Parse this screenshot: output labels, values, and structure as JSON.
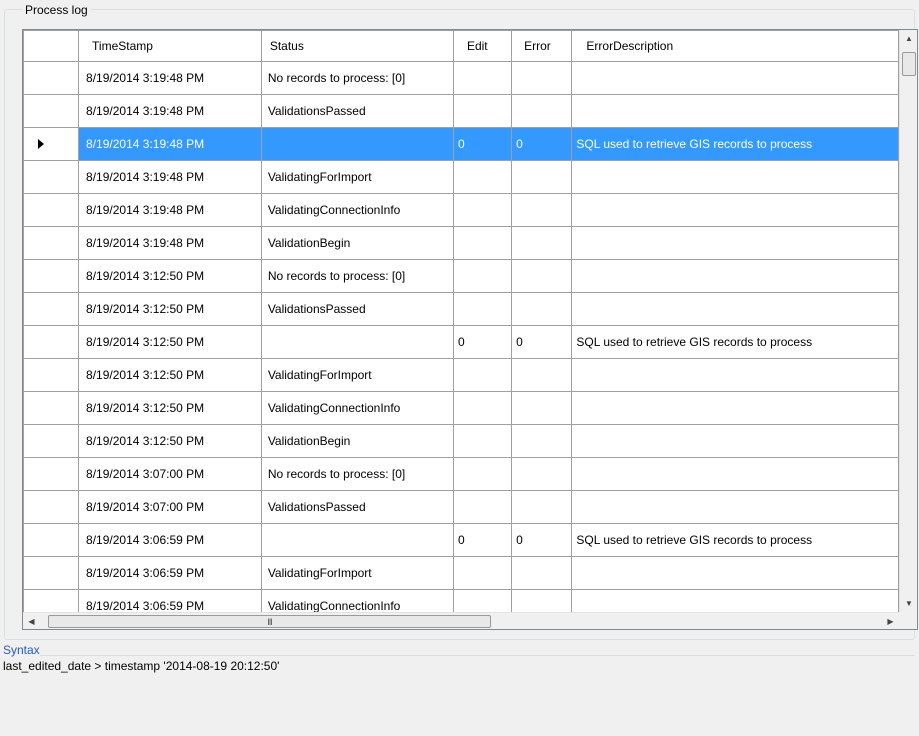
{
  "process_log": {
    "title": "Process log",
    "columns": [
      "TimeStamp",
      "Status",
      "Edit",
      "Error",
      "ErrorDescription"
    ],
    "selected_row": 2,
    "rows": [
      {
        "timestamp": "8/19/2014 3:19:48 PM",
        "status": "No records to process: [0]",
        "edit": "",
        "error": "",
        "description": ""
      },
      {
        "timestamp": "8/19/2014 3:19:48 PM",
        "status": "ValidationsPassed",
        "edit": "",
        "error": "",
        "description": ""
      },
      {
        "timestamp": "8/19/2014 3:19:48 PM",
        "status": "",
        "edit": "0",
        "error": "0",
        "description": "SQL used to retrieve GIS records to process"
      },
      {
        "timestamp": "8/19/2014 3:19:48 PM",
        "status": "ValidatingForImport",
        "edit": "",
        "error": "",
        "description": ""
      },
      {
        "timestamp": "8/19/2014 3:19:48 PM",
        "status": "ValidatingConnectionInfo",
        "edit": "",
        "error": "",
        "description": ""
      },
      {
        "timestamp": "8/19/2014 3:19:48 PM",
        "status": "ValidationBegin",
        "edit": "",
        "error": "",
        "description": ""
      },
      {
        "timestamp": "8/19/2014 3:12:50 PM",
        "status": "No records to process: [0]",
        "edit": "",
        "error": "",
        "description": ""
      },
      {
        "timestamp": "8/19/2014 3:12:50 PM",
        "status": "ValidationsPassed",
        "edit": "",
        "error": "",
        "description": ""
      },
      {
        "timestamp": "8/19/2014 3:12:50 PM",
        "status": "",
        "edit": "0",
        "error": "0",
        "description": "SQL used to retrieve GIS records to process"
      },
      {
        "timestamp": "8/19/2014 3:12:50 PM",
        "status": "ValidatingForImport",
        "edit": "",
        "error": "",
        "description": ""
      },
      {
        "timestamp": "8/19/2014 3:12:50 PM",
        "status": "ValidatingConnectionInfo",
        "edit": "",
        "error": "",
        "description": ""
      },
      {
        "timestamp": "8/19/2014 3:12:50 PM",
        "status": "ValidationBegin",
        "edit": "",
        "error": "",
        "description": ""
      },
      {
        "timestamp": "8/19/2014 3:07:00 PM",
        "status": "No records to process: [0]",
        "edit": "",
        "error": "",
        "description": ""
      },
      {
        "timestamp": "8/19/2014 3:07:00 PM",
        "status": "ValidationsPassed",
        "edit": "",
        "error": "",
        "description": ""
      },
      {
        "timestamp": "8/19/2014 3:06:59 PM",
        "status": "",
        "edit": "0",
        "error": "0",
        "description": "SQL used to retrieve GIS records to process"
      },
      {
        "timestamp": "8/19/2014 3:06:59 PM",
        "status": "ValidatingForImport",
        "edit": "",
        "error": "",
        "description": ""
      },
      {
        "timestamp": "8/19/2014 3:06:59 PM",
        "status": "ValidatingConnectionInfo",
        "edit": "",
        "error": "",
        "description": ""
      }
    ]
  },
  "scrollbar": {
    "hthumb_glyph": "III"
  },
  "syntax": {
    "label": "Syntax",
    "text": "last_edited_date > timestamp '2014-08-19 20:12:50'"
  },
  "colors": {
    "selection": "#3399ff",
    "syntax_label": "#1f5fbf"
  }
}
